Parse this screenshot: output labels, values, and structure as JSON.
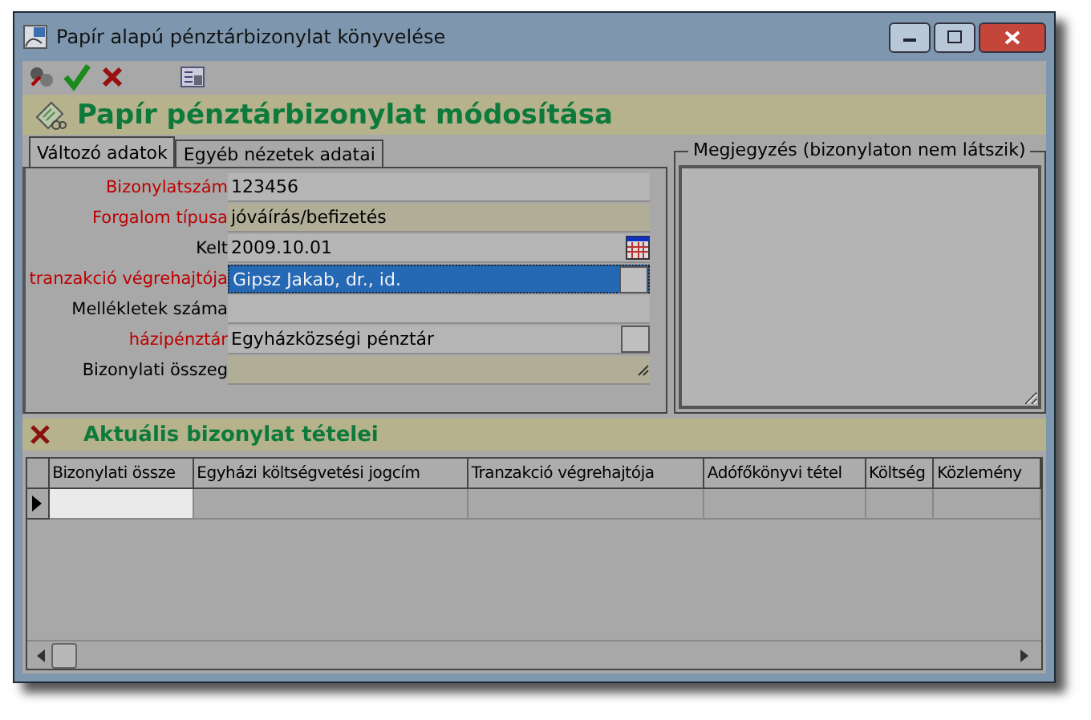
{
  "window": {
    "title": "Papír alapú pénztárbizonylat könyvelése"
  },
  "toolbar": [
    {
      "kind": "tools"
    },
    {
      "kind": "ok"
    },
    {
      "kind": "cancel"
    },
    {
      "kind": "form"
    }
  ],
  "header": {
    "title": "Papír pénztárbizonylat módosítása"
  },
  "tabs": [
    {
      "label": "Változó adatok",
      "selected": true
    },
    {
      "label": "Egyéb nézetek adatai",
      "selected": false
    }
  ],
  "fields": [
    {
      "label": "Bizonylatszám",
      "value": "123456",
      "required": true,
      "kind": "text",
      "shaded": false,
      "selected": false
    },
    {
      "label": "Forgalom típusa",
      "value": "jóváírás/befizetés",
      "required": true,
      "kind": "text",
      "shaded": true,
      "selected": false
    },
    {
      "label": "Kelt",
      "value": "2009.10.01",
      "required": false,
      "kind": "date",
      "shaded": false,
      "selected": false
    },
    {
      "label": "tranzakció végrehajtója",
      "value": "Gipsz Jakab, dr., id.",
      "required": true,
      "kind": "lookup",
      "shaded": false,
      "selected": true
    },
    {
      "label": "Mellékletek száma",
      "required": false,
      "kind": "text",
      "shaded": false,
      "selected": false
    },
    {
      "label": "házipénztár",
      "value": "Egyházközségi pénztár",
      "required": true,
      "kind": "lookup",
      "shaded": false,
      "selected": false
    },
    {
      "label": "Bizonylati összeg",
      "required": false,
      "kind": "memo",
      "shaded": true,
      "selected": false
    }
  ],
  "notes": {
    "label": "Megjegyzés (bizonylaton nem látszik)"
  },
  "items": {
    "title": "Aktuális bizonylat tételei",
    "columns": [
      "Bizonylati össze",
      "Egyházi költségvetési jogcím",
      "Tranzakció végrehajtója",
      "Adófőkönyvi tétel",
      "Költség",
      "Közlemény"
    ],
    "rows": [
      {
        "current": true
      }
    ]
  }
}
